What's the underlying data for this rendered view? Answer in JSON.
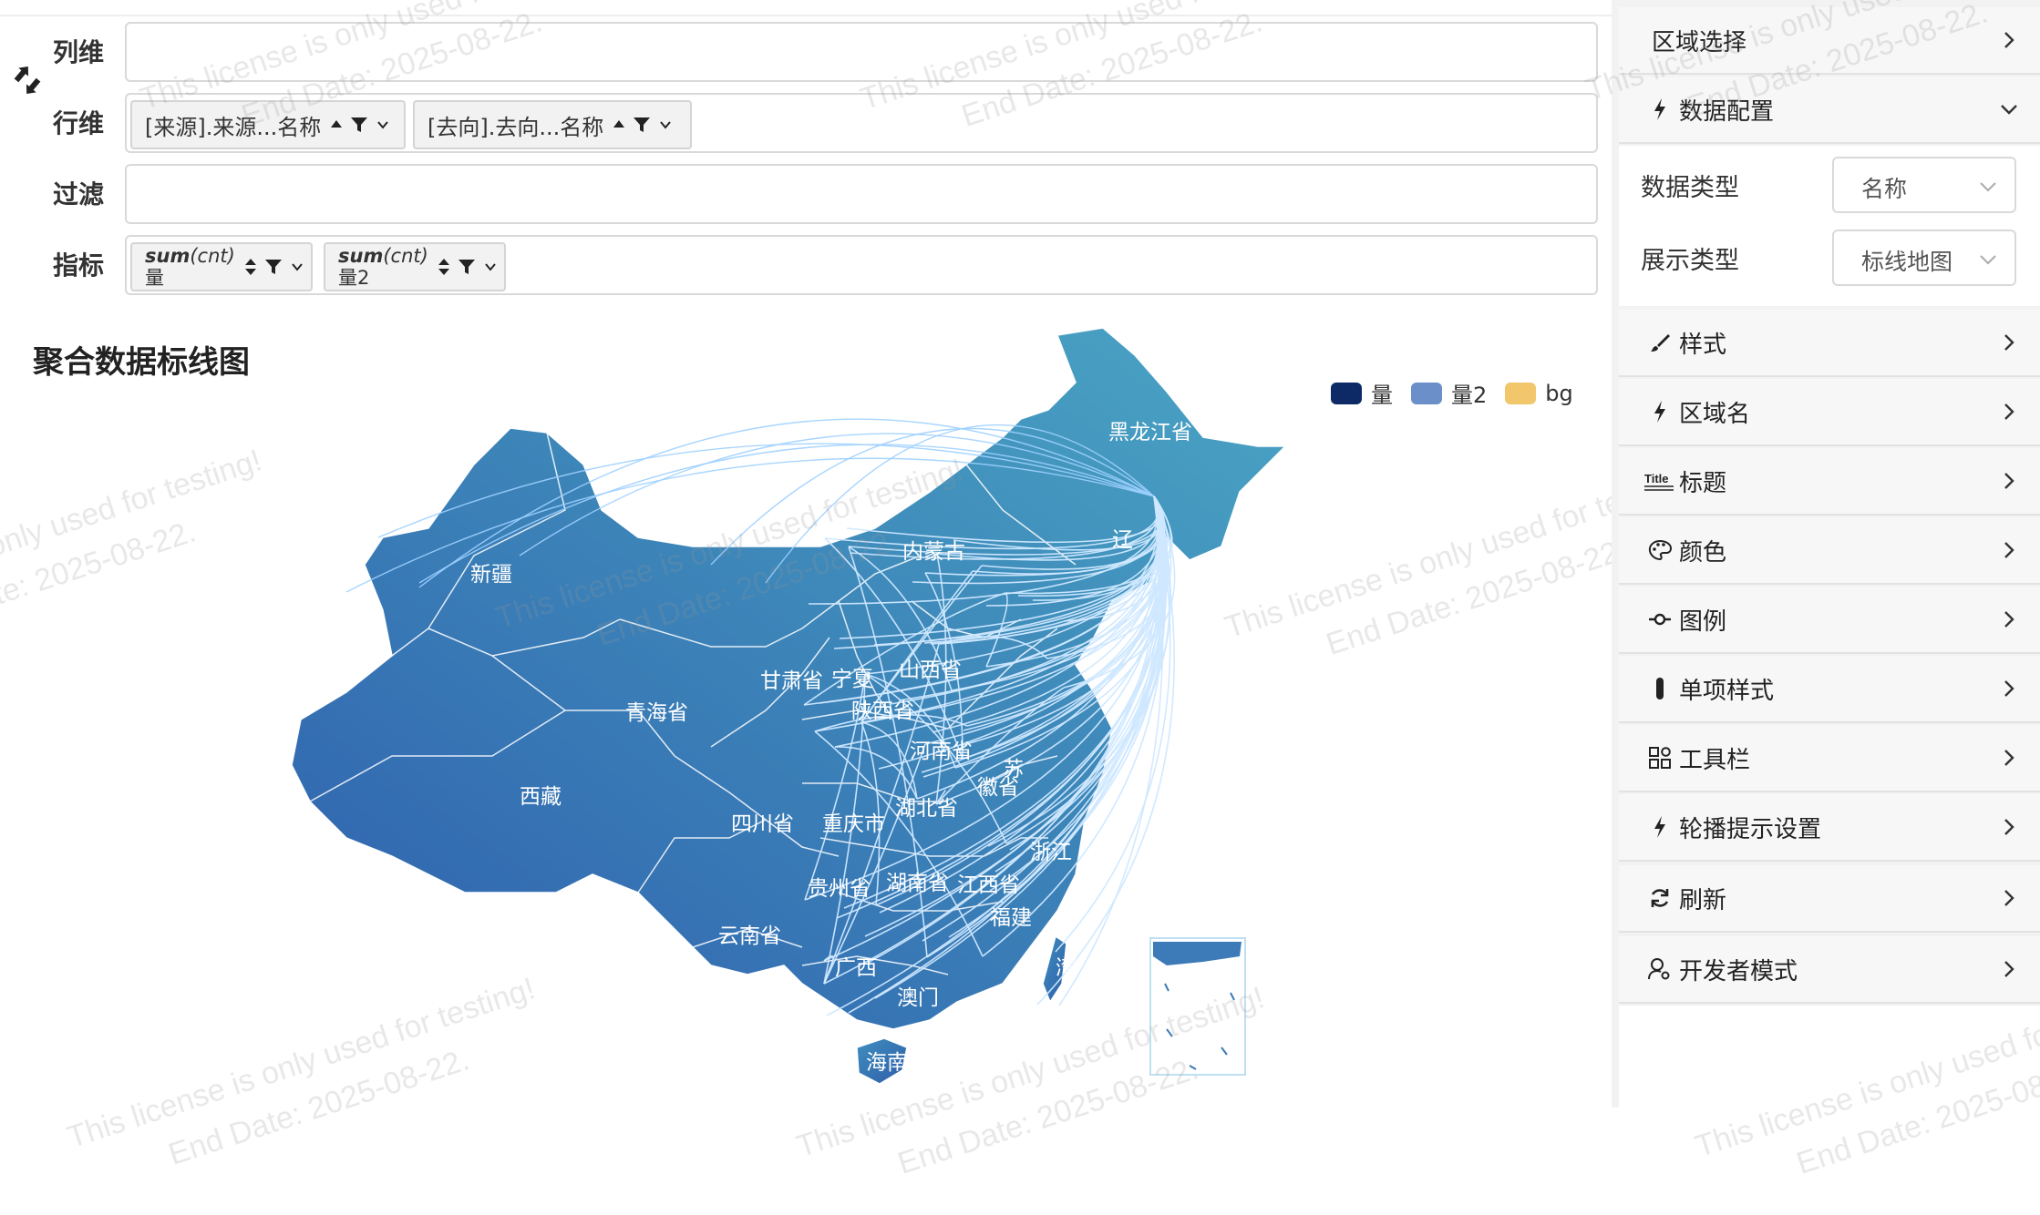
{
  "dimensions": {
    "column": {
      "label": "列维"
    },
    "row": {
      "label": "行维",
      "pills": [
        "[来源].来源...名称",
        "[去向].去向...名称"
      ]
    },
    "filter": {
      "label": "过滤"
    },
    "metric": {
      "label": "指标",
      "pills": [
        {
          "func": "sum",
          "arg": "(cnt)",
          "name": "量"
        },
        {
          "func": "sum",
          "arg": "(cnt)",
          "name": "量2"
        }
      ]
    }
  },
  "chart": {
    "title": "聚合数据标线图",
    "legend": [
      {
        "name": "量",
        "color": "#0d2a66"
      },
      {
        "name": "量2",
        "color": "#6b8fc9"
      },
      {
        "name": "bg",
        "color": "#f2c66b"
      }
    ],
    "region_labels": [
      "黑龙江省",
      "内蒙古",
      "新疆",
      "甘肃省",
      "宁夏",
      "山西省",
      "陕西省",
      "青海省",
      "河南省",
      "西藏",
      "四川省",
      "重庆市",
      "湖北省",
      "浙江",
      "贵州省",
      "湖南省",
      "江西省",
      "福建",
      "云南省",
      "广西",
      "澳门",
      "海南",
      "湾",
      "辽",
      "苏",
      "徽省"
    ]
  },
  "watermark": {
    "line1": "This license is only used for testing!",
    "line2": "End Date: 2025-08-22."
  },
  "panel": {
    "region_select": "区域选择",
    "data_config": "数据配置",
    "data_type_label": "数据类型",
    "data_type_value": "名称",
    "display_type_label": "展示类型",
    "display_type_value": "标线地图",
    "sections": [
      {
        "label": "样式",
        "icon": "brush-icon"
      },
      {
        "label": "区域名",
        "icon": "bolt-icon"
      },
      {
        "label": "标题",
        "icon": "title-icon"
      },
      {
        "label": "颜色",
        "icon": "palette-icon"
      },
      {
        "label": "图例",
        "icon": "legend-icon"
      },
      {
        "label": "单项样式",
        "icon": "bar-icon"
      },
      {
        "label": "工具栏",
        "icon": "widgets-icon"
      },
      {
        "label": "轮播提示设置",
        "icon": "bolt-icon"
      },
      {
        "label": "刷新",
        "icon": "refresh-icon"
      },
      {
        "label": "开发者模式",
        "icon": "user-gear-icon"
      }
    ]
  }
}
